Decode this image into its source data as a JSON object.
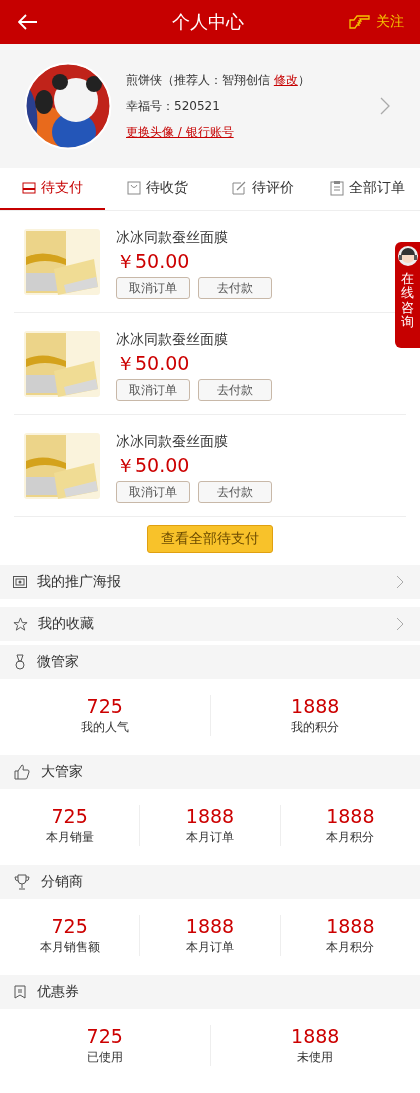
{
  "header": {
    "title": "个人中心",
    "follow_label": "关注"
  },
  "profile": {
    "name_prefix": "煎饼侠（推荐人：智翔创信",
    "edit_link": "修改",
    "name_suffix": "）",
    "member_id": "幸福号：520521",
    "change_link": "更换头像 / 银行账号"
  },
  "tabs": [
    {
      "label": "待支付",
      "kind": "card",
      "selected": true
    },
    {
      "label": "待收货",
      "kind": "box",
      "selected": false
    },
    {
      "label": "待评价",
      "kind": "edit",
      "selected": false
    },
    {
      "label": "全部订单",
      "kind": "clipboard",
      "selected": false
    }
  ],
  "orders": [
    {
      "title": "冰冰同款蚕丝面膜",
      "price": "￥50.00",
      "buttons": [
        "取消订单",
        "去付款"
      ]
    },
    {
      "title": "冰冰同款蚕丝面膜",
      "price": "￥50.00",
      "buttons": [
        "取消订单",
        "去付款"
      ]
    },
    {
      "title": "冰冰同款蚕丝面膜",
      "price": "￥50.00",
      "buttons": [
        "取消订单",
        "去付款"
      ]
    }
  ],
  "view_all_button": "查看全部待支付",
  "menu": [
    {
      "label": "我的推广海报",
      "kind": "poster"
    },
    {
      "label": "我的收藏",
      "kind": "star"
    }
  ],
  "sections": [
    {
      "title": "微管家",
      "kind": "medal",
      "stats": [
        {
          "value": "725",
          "label": "我的人气"
        },
        {
          "value": "1888",
          "label": "我的积分"
        }
      ]
    },
    {
      "title": "大管家",
      "kind": "thumb",
      "stats": [
        {
          "value": "725",
          "label": "本月销量"
        },
        {
          "value": "1888",
          "label": "本月订单"
        },
        {
          "value": "1888",
          "label": "本月积分"
        }
      ]
    },
    {
      "title": "分销商",
      "kind": "trophy",
      "stats": [
        {
          "value": "725",
          "label": "本月销售额"
        },
        {
          "value": "1888",
          "label": "本月订单"
        },
        {
          "value": "1888",
          "label": "本月积分"
        }
      ]
    },
    {
      "title": "优惠券",
      "kind": "coupon",
      "stats": [
        {
          "value": "725",
          "label": "已使用"
        },
        {
          "value": "1888",
          "label": "未使用"
        }
      ]
    }
  ],
  "consult_tab": "在线咨询"
}
